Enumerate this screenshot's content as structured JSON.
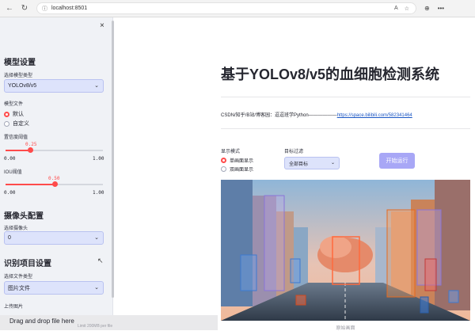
{
  "browser": {
    "url": "localhost:8501",
    "reader_icon": "A",
    "tools": [
      "↻",
      "⊕",
      "•••"
    ]
  },
  "sidebar": {
    "close_icon": "×",
    "model_section": {
      "heading": "模型设置",
      "model_type_label": "选择模型类型",
      "model_type_value": "YOLOv8/v5",
      "model_file_label": "模型文件",
      "model_file_options": [
        "默认",
        "自定义"
      ],
      "confidence_label": "置信度阈值",
      "confidence": {
        "value": "0.25",
        "min": "0.00",
        "max": "1.00",
        "fraction": 0.25
      },
      "iou_label": "IOU阈值",
      "iou": {
        "value": "0.50",
        "min": "0.00",
        "max": "1.00",
        "fraction": 0.5
      }
    },
    "camera_section": {
      "heading": "摄像头配置",
      "camera_label": "选择摄像头",
      "camera_value": "0"
    },
    "recognition_section": {
      "heading": "识别项目设置",
      "file_type_label": "选择文件类型",
      "file_type_value": "图片文件",
      "upload_label": "上传图片"
    }
  },
  "dropzone": {
    "text": "Drag and drop file here",
    "limit": "Limit 200MB per file"
  },
  "main": {
    "title": "基于YOLOv8/v5的血细胞检测系统",
    "credit_text": "CSDN/知乎/B站/博客园：逗逗班学Python——————",
    "credit_link": "https://space.bilibili.com/582341464",
    "display_mode_label": "显示模式",
    "display_modes": [
      "单画面显示",
      "双画面显示"
    ],
    "target_filter_label": "目标过滤",
    "target_filter_value": "全部目标",
    "run_button": "开始运行",
    "image_caption": "原始画面"
  },
  "colors": {
    "accent": "#ff4b4b",
    "sidebar_bg": "#f0f2f6",
    "select_bg": "#dde3fb",
    "run_button": "#a8a7f6",
    "link": "#1a56c4"
  }
}
